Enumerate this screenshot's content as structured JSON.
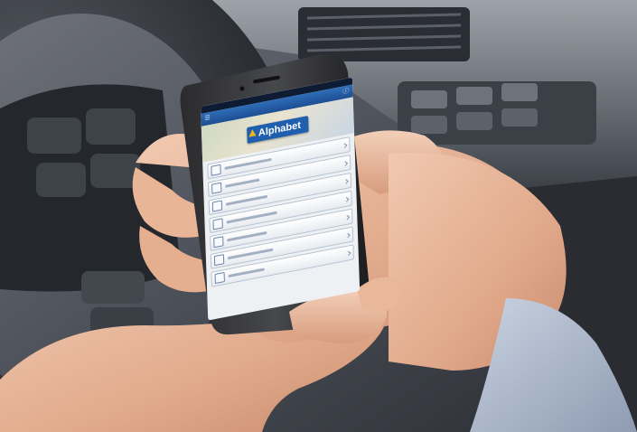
{
  "phone": {
    "status_left": "",
    "status_time": "",
    "status_right": "",
    "header_title": "",
    "header_left_icon": "menu-icon",
    "header_right_icon": "info-icon",
    "logo_text": "Alphabet",
    "menu_items": [
      {
        "icon": "car-icon",
        "label": ""
      },
      {
        "icon": "document-icon",
        "label": ""
      },
      {
        "icon": "phone-icon",
        "label": ""
      },
      {
        "icon": "wrench-icon",
        "label": ""
      },
      {
        "icon": "fuel-icon",
        "label": ""
      },
      {
        "icon": "location-icon",
        "label": ""
      },
      {
        "icon": "settings-icon",
        "label": ""
      }
    ]
  },
  "colors": {
    "app_blue": "#1f5fae",
    "logo_yellow": "#f2b21c",
    "dashboard_dark": "#2b2f36"
  }
}
